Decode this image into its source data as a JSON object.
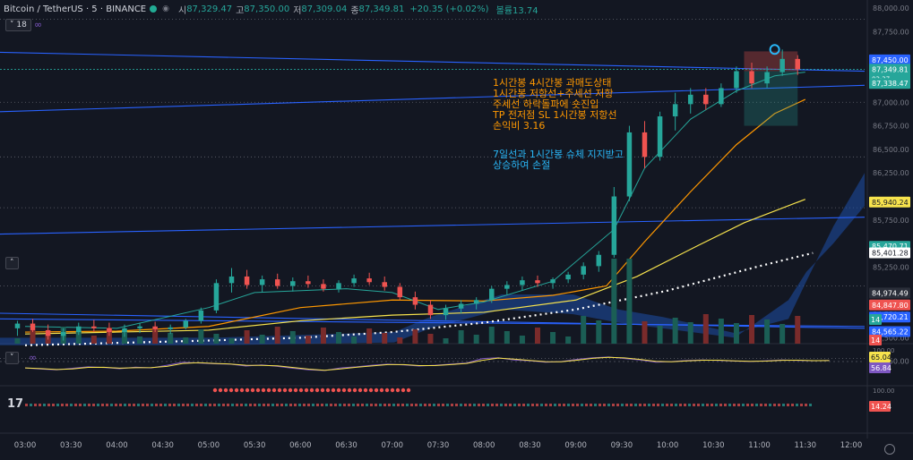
{
  "header": {
    "symbol": "Bitcoin / TetherUS · 5 · BINANCE",
    "open_label": "시",
    "open": "87,329.47",
    "high_label": "고",
    "high": "87,350.00",
    "low_label": "저",
    "low": "87,309.04",
    "close_label": "종",
    "close": "87,349.81",
    "change": "+20.35 (+0.02%)",
    "volume_label": "볼륨",
    "volume": "13.74",
    "indicator_count": "18"
  },
  "annotations": {
    "orange_lines": [
      "1시간봉 4시간봉 과매도상태",
      "1시간봉 저항선+주세선 저항",
      "주세선 하락돌파에 숏진입",
      "TP 전저점 SL 1시간봉 저항선",
      "손익비 3.16"
    ],
    "cyan_lines": [
      "7일선과 1시간봉 슈체 지지받고",
      "상승하여 손절"
    ]
  },
  "chart_data": {
    "type": "candlestick",
    "symbol": "BTCUSDT",
    "interval": "5m",
    "exchange": "BINANCE",
    "price_ylim": [
      84100,
      88000
    ],
    "price_ticks": [
      88000,
      87750,
      87450,
      87000,
      86750,
      86500,
      86250,
      85750,
      85250,
      84750,
      84500,
      84250
    ],
    "time_ticks": [
      "03:00",
      "03:30",
      "04:00",
      "04:30",
      "05:00",
      "05:30",
      "06:00",
      "06:30",
      "07:00",
      "07:30",
      "08:00",
      "08:30",
      "09:00",
      "09:30",
      "10:00",
      "10:30",
      "11:00",
      "11:30",
      "12:00"
    ],
    "price_labels": [
      {
        "value": "87,450.00",
        "price": 87450,
        "color": "#2962ff"
      },
      {
        "value": "87,349.81",
        "price": 87349.81,
        "color": "#26a69a",
        "sub": "03:37"
      },
      {
        "value": "87,338.47",
        "price": 87200,
        "color": "#26a69a"
      },
      {
        "value": "85,940.24",
        "price": 85940.24,
        "color": "#f7e34d"
      },
      {
        "value": "85,470.71",
        "price": 85470.71,
        "color": "#26a69a"
      },
      {
        "value": "85,401.28",
        "price": 85401.28,
        "color": "#ffffff"
      },
      {
        "value": "84,974.49",
        "price": 84974.49,
        "color": "#2a2e39"
      },
      {
        "value": "84,847.80",
        "price": 84847.8,
        "color": "#ef5350"
      },
      {
        "value": "84,720.21",
        "price": 84720.21,
        "color": "#2962ff"
      },
      {
        "value": "84,565.22",
        "price": 84565.22,
        "color": "#2962ff"
      }
    ],
    "volume_label": "14",
    "rsi_panel": {
      "ticks": [
        "100.00"
      ],
      "labels": [
        "65.04",
        "56.84"
      ],
      "extra_label": "14"
    },
    "macd_panel": {
      "ticks": [
        "100.00"
      ],
      "label": "14.24"
    },
    "candles": [
      {
        "t": "02:55",
        "o": 84600,
        "h": 84680,
        "l": 84520,
        "c": 84650
      },
      {
        "t": "03:05",
        "o": 84650,
        "h": 84700,
        "l": 84560,
        "c": 84580
      },
      {
        "t": "03:15",
        "o": 84580,
        "h": 84640,
        "l": 84480,
        "c": 84520
      },
      {
        "t": "03:25",
        "o": 84520,
        "h": 84600,
        "l": 84470,
        "c": 84560
      },
      {
        "t": "03:35",
        "o": 84560,
        "h": 84660,
        "l": 84530,
        "c": 84620
      },
      {
        "t": "03:45",
        "o": 84620,
        "h": 84690,
        "l": 84560,
        "c": 84600
      },
      {
        "t": "03:55",
        "o": 84600,
        "h": 84660,
        "l": 84520,
        "c": 84560
      },
      {
        "t": "04:05",
        "o": 84560,
        "h": 84640,
        "l": 84510,
        "c": 84600
      },
      {
        "t": "04:15",
        "o": 84600,
        "h": 84660,
        "l": 84550,
        "c": 84620
      },
      {
        "t": "04:25",
        "o": 84620,
        "h": 84670,
        "l": 84560,
        "c": 84590
      },
      {
        "t": "04:35",
        "o": 84590,
        "h": 84640,
        "l": 84540,
        "c": 84610
      },
      {
        "t": "04:45",
        "o": 84610,
        "h": 84700,
        "l": 84590,
        "c": 84680
      },
      {
        "t": "04:55",
        "o": 84680,
        "h": 84820,
        "l": 84650,
        "c": 84790
      },
      {
        "t": "05:05",
        "o": 84790,
        "h": 85120,
        "l": 84760,
        "c": 85080
      },
      {
        "t": "05:15",
        "o": 85080,
        "h": 85240,
        "l": 84980,
        "c": 85150
      },
      {
        "t": "05:25",
        "o": 85150,
        "h": 85220,
        "l": 85020,
        "c": 85060
      },
      {
        "t": "05:35",
        "o": 85060,
        "h": 85160,
        "l": 84980,
        "c": 85120
      },
      {
        "t": "05:45",
        "o": 85120,
        "h": 85180,
        "l": 85020,
        "c": 85050
      },
      {
        "t": "05:55",
        "o": 85050,
        "h": 85140,
        "l": 84990,
        "c": 85100
      },
      {
        "t": "06:05",
        "o": 85100,
        "h": 85160,
        "l": 85030,
        "c": 85070
      },
      {
        "t": "06:15",
        "o": 85070,
        "h": 85120,
        "l": 84990,
        "c": 85020
      },
      {
        "t": "06:25",
        "o": 85020,
        "h": 85110,
        "l": 84980,
        "c": 85080
      },
      {
        "t": "06:35",
        "o": 85080,
        "h": 85170,
        "l": 85040,
        "c": 85130
      },
      {
        "t": "06:45",
        "o": 85130,
        "h": 85190,
        "l": 85060,
        "c": 85090
      },
      {
        "t": "06:55",
        "o": 85090,
        "h": 85150,
        "l": 85000,
        "c": 85040
      },
      {
        "t": "07:05",
        "o": 85040,
        "h": 85080,
        "l": 84900,
        "c": 84930
      },
      {
        "t": "07:15",
        "o": 84930,
        "h": 84990,
        "l": 84800,
        "c": 84850
      },
      {
        "t": "07:25",
        "o": 84850,
        "h": 84900,
        "l": 84700,
        "c": 84740
      },
      {
        "t": "07:35",
        "o": 84740,
        "h": 84850,
        "l": 84690,
        "c": 84810
      },
      {
        "t": "07:45",
        "o": 84810,
        "h": 84900,
        "l": 84760,
        "c": 84860
      },
      {
        "t": "07:55",
        "o": 84860,
        "h": 84930,
        "l": 84800,
        "c": 84900
      },
      {
        "t": "08:05",
        "o": 84900,
        "h": 85050,
        "l": 84870,
        "c": 85020
      },
      {
        "t": "08:15",
        "o": 85020,
        "h": 85100,
        "l": 84960,
        "c": 85060
      },
      {
        "t": "08:25",
        "o": 85060,
        "h": 85150,
        "l": 85000,
        "c": 85110
      },
      {
        "t": "08:35",
        "o": 85110,
        "h": 85160,
        "l": 85040,
        "c": 85080
      },
      {
        "t": "08:45",
        "o": 85080,
        "h": 85140,
        "l": 85020,
        "c": 85120
      },
      {
        "t": "08:55",
        "o": 85120,
        "h": 85200,
        "l": 85080,
        "c": 85170
      },
      {
        "t": "09:05",
        "o": 85170,
        "h": 85300,
        "l": 85120,
        "c": 85260
      },
      {
        "t": "09:15",
        "o": 85260,
        "h": 85420,
        "l": 85200,
        "c": 85380
      },
      {
        "t": "09:25",
        "o": 85380,
        "h": 86100,
        "l": 85350,
        "c": 86000
      },
      {
        "t": "09:35",
        "o": 86000,
        "h": 86750,
        "l": 85950,
        "c": 86680
      },
      {
        "t": "09:45",
        "o": 86680,
        "h": 86800,
        "l": 86300,
        "c": 86420
      },
      {
        "t": "09:55",
        "o": 86420,
        "h": 86900,
        "l": 86380,
        "c": 86850
      },
      {
        "t": "10:05",
        "o": 86850,
        "h": 87100,
        "l": 86700,
        "c": 86980
      },
      {
        "t": "10:15",
        "o": 86980,
        "h": 87150,
        "l": 86880,
        "c": 87080
      },
      {
        "t": "10:25",
        "o": 87080,
        "h": 87150,
        "l": 86920,
        "c": 86980
      },
      {
        "t": "10:35",
        "o": 86980,
        "h": 87200,
        "l": 86950,
        "c": 87150
      },
      {
        "t": "10:45",
        "o": 87150,
        "h": 87380,
        "l": 87100,
        "c": 87330
      },
      {
        "t": "10:55",
        "o": 87330,
        "h": 87420,
        "l": 87150,
        "c": 87200
      },
      {
        "t": "11:05",
        "o": 87200,
        "h": 87380,
        "l": 87150,
        "c": 87320
      },
      {
        "t": "11:15",
        "o": 87320,
        "h": 87560,
        "l": 87280,
        "c": 87460
      },
      {
        "t": "11:25",
        "o": 87460,
        "h": 87500,
        "l": 87290,
        "c": 87349.81
      }
    ]
  }
}
